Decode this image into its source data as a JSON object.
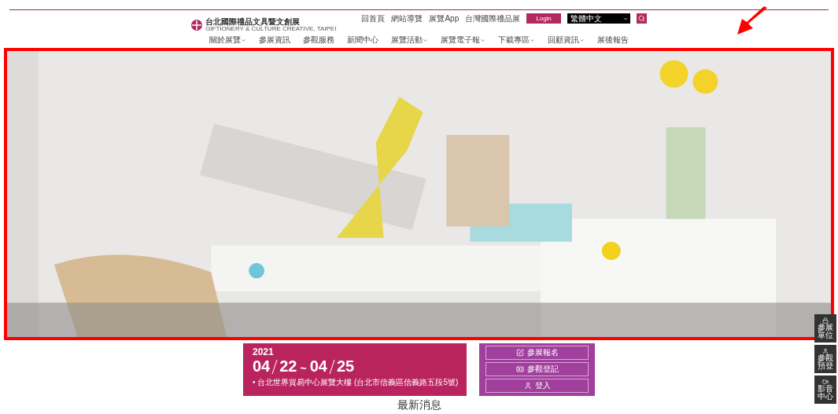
{
  "logo": {
    "title": "台北國際禮品文具暨文創展",
    "subtitle": "GIFTIONERY & CULTURE CREATIVE, TAIPEI"
  },
  "top_links": [
    "回首頁",
    "網站導覽",
    "展覽App",
    "台灣國際禮品展"
  ],
  "login_button": "Login",
  "language": {
    "value": "繁體中文"
  },
  "nav": [
    {
      "label": "關於展覽",
      "has_submenu": true
    },
    {
      "label": "參展資訊",
      "has_submenu": false
    },
    {
      "label": "參觀服務",
      "has_submenu": false
    },
    {
      "label": "新聞中心",
      "has_submenu": false
    },
    {
      "label": "展覽活動",
      "has_submenu": true
    },
    {
      "label": "展覽電子報",
      "has_submenu": true
    },
    {
      "label": "下載專區",
      "has_submenu": true
    },
    {
      "label": "回顧資訊",
      "has_submenu": true
    },
    {
      "label": "展後報告",
      "has_submenu": false
    }
  ],
  "event": {
    "year": "2021",
    "start": "04",
    "start_day": "22",
    "separator": "~",
    "end": "04",
    "end_day": "25",
    "location": "• 台北世界貿易中心展覽大樓 (台北市信義區信義路五段5號)"
  },
  "actions": [
    {
      "label": "參展報名",
      "kind": "edit"
    },
    {
      "label": "參觀登記",
      "kind": "card"
    },
    {
      "label": "登入",
      "kind": "person"
    }
  ],
  "side_buttons": [
    {
      "label": "參展單位",
      "kind": "lock"
    },
    {
      "label": "參觀預登",
      "kind": "person"
    },
    {
      "label": "影音中心",
      "kind": "video"
    }
  ],
  "section_heading": "最新消息"
}
